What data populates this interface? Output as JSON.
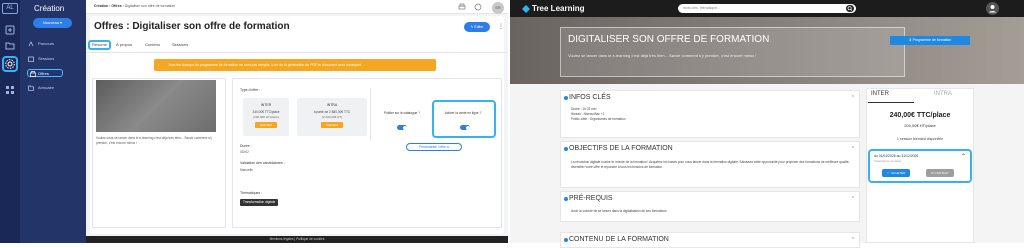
{
  "admin": {
    "logo": "AL",
    "section_title": "Création",
    "new_button": "Nouveau",
    "nav": [
      {
        "label": "Parcours",
        "icon": "route-icon"
      },
      {
        "label": "Sessions",
        "icon": "calendar-icon"
      },
      {
        "label": "Offres",
        "icon": "shop-icon"
      },
      {
        "label": "Annuaire",
        "icon": "folder-icon"
      }
    ],
    "breadcrumb": {
      "a": "Création",
      "b": "Offres",
      "c": "Digitaliser son offre de formation"
    },
    "avatar": "SR",
    "page_title": "Offres : Digitaliser son offre de formation",
    "edit_button": "Éditer",
    "tabs": [
      "Résumé",
      "À propos",
      "Contenu",
      "Sessions"
    ],
    "warning": "Tous les champs du programme de formation ne sont pas remplis. Lors de la génération du PDF le document sera incomplet.",
    "description": "Voulez-vous se lancer dans le e-learning c'est déjà très bien... Savoir comment s'y prendre, c'est encore mieux !",
    "offer_type_label": "Type d'offre :",
    "inter": {
      "title": "INTER",
      "price": "240,00€ TTC/place",
      "sub": "(200,00€ HT/place)",
      "button": "Standard"
    },
    "intra": {
      "title": "INTRA",
      "price": "à partir de 2 880,00€ TTC",
      "sub": "(2 400,00€ HT)",
      "button": "Standard"
    },
    "publish_label": "Publier sur le catalogue ?",
    "sale_label": "Activer la vente en ligne ?",
    "preview_button": "Prévisualiser l'offre",
    "duration_label": "Durée :",
    "duration_value": "01h02",
    "validation_label": "Validation des candidatures :",
    "validation_value": "Manuelle",
    "themes_label": "Thématiques :",
    "theme_tag": "Transformation digitale",
    "footer": "Mentions légales | Politique de cookies"
  },
  "site": {
    "brand": "Tree Learning",
    "search_placeholder": "mots clés, thématique...",
    "hero_title": "DIGITALISER SON OFFRE DE FORMATION",
    "hero_sub": "Voulez se lancer dans le e-learning c'est déjà très bien... Savoir comment s'y prendre, c'est encore mieux !",
    "program_button": "Programme de formation",
    "key_info_title": "INFOS CLÉS",
    "key_info": [
      "Durée : 1h 02 min",
      "Niveau : Niveau Bac +2",
      "Public cible : Organismes de formation"
    ],
    "objectives_title": "OBJECTIFS DE LA FORMATION",
    "objectives_text": "La révolution digitale touche le monde de la formation ! Acquérez les bases pour vous lancer dans la formation digitale. Saisissez cette opportunité pour proposer des formations de meilleure qualité, diversifier votre offre et répondre à tous les besoins de formation.",
    "prereq_title": "PRÉ-REQUIS",
    "prereq_text": "Avoir la volonté de se lancer dans la digitalisation de ses formations",
    "content_title": "CONTENU DE LA FORMATION",
    "price_tabs": [
      "INTER",
      "INTRA"
    ],
    "price": "240,00€ TTC/place",
    "price_ht": "200,00€ HT/place",
    "session_info": "1 session blended disponible",
    "session_dates": "du 01/01/2026 au 31/12/2026",
    "session_status": "Inscriptions ouvertes",
    "buy_button": "ACHETER",
    "contact_button": "CONTACT"
  }
}
